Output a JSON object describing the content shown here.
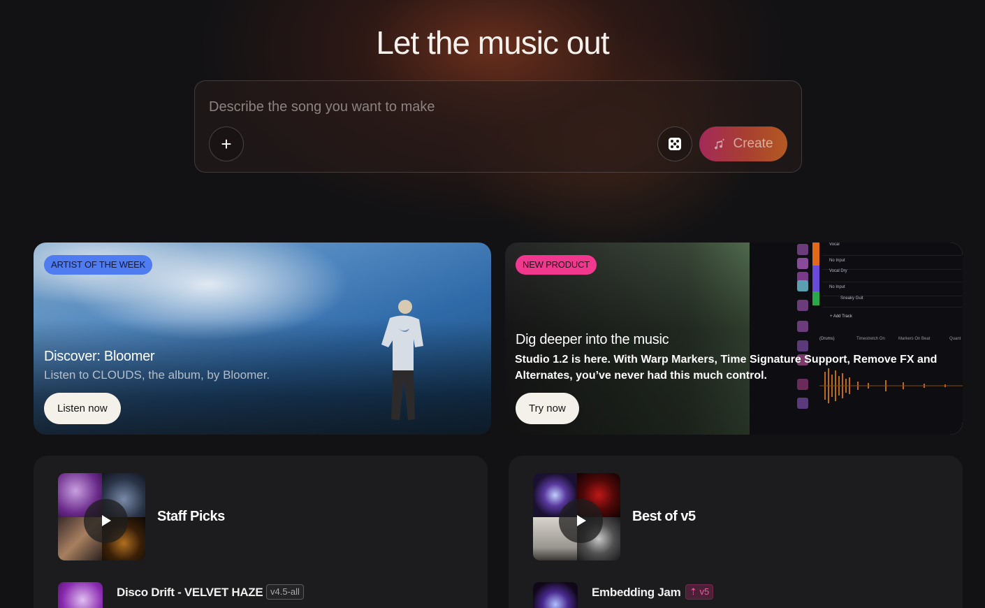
{
  "hero": {
    "title": "Let the music out",
    "prompt_placeholder": "Describe the song you want to make",
    "create_label": "Create"
  },
  "promos": [
    {
      "badge": "ARTIST OF THE WEEK",
      "title": "Discover: Bloomer",
      "subtitle": "Listen to CLOUDS, the album, by Bloomer.",
      "button_label": "Listen now"
    },
    {
      "badge": "NEW PRODUCT",
      "title": "Dig deeper into the music",
      "description": "Studio 1.2 is here. With Warp Markers, Time Signature Support, Remove FX and Alternates, you’ve never had this much control.",
      "button_label": "Try now",
      "daw_labels": {
        "track1": "Vocal",
        "input1": "No Input",
        "track2": "Vocal Dry",
        "input2": "No Input",
        "track3": "Sneaky Guit",
        "add_track": "+ Add Track",
        "drums": "(Drums)",
        "timestretch": "Timestretch On",
        "markers": "Markers On Beat",
        "quant": "Quant"
      }
    }
  ],
  "playlists": [
    {
      "title": "Staff Picks",
      "song": {
        "title": "Disco Drift - VELVET HAZE",
        "tag": "v4.5-all"
      }
    },
    {
      "title": "Best of v5",
      "song": {
        "title": "Embedding Jam",
        "tag": "v5"
      }
    }
  ],
  "colors": {
    "badge_blue": "#4f7cf0",
    "badge_pink": "#f0388f",
    "create_gradient_start": "#a3295a",
    "create_gradient_end": "#b35a22"
  }
}
